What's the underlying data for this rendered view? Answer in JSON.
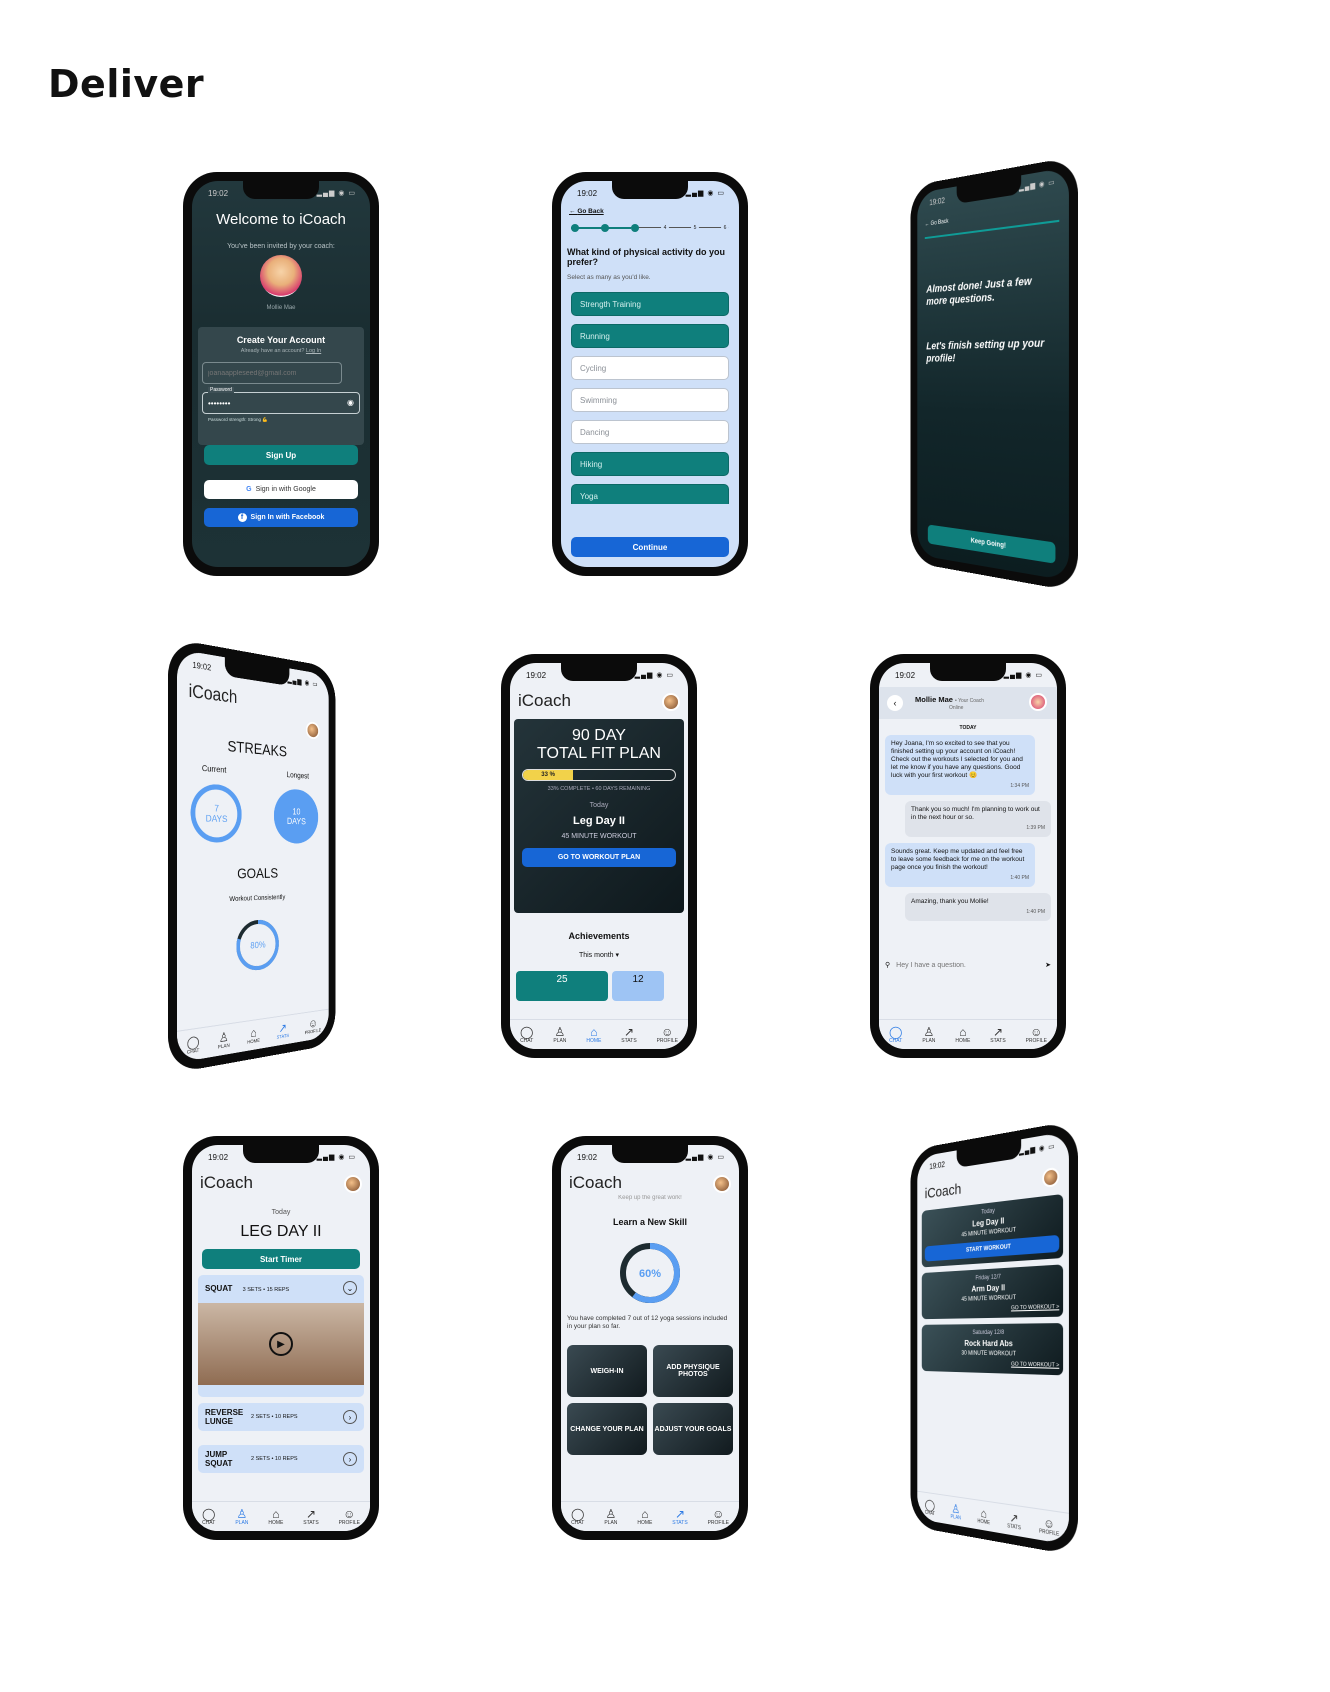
{
  "heading": "Deliver",
  "status_time": "19:02",
  "signup": {
    "title": "Welcome to iCoach",
    "invited": "You've been invited by your coach:",
    "coach_name": "Mollie Mae",
    "create": "Create Your Account",
    "have_account": "Already have an account?",
    "login": "Log In",
    "email_placeholder": "joanaappleseed@gmail.com",
    "password_label": "Password",
    "password_value": "••••••••",
    "strength": "Password strength: Strong 💪",
    "signup_btn": "Sign Up",
    "google_btn": "Sign in with Google",
    "facebook_btn": "Sign In with Facebook"
  },
  "quiz": {
    "back": "Go Back",
    "steps": [
      "1",
      "2",
      "3",
      "4",
      "5",
      "6"
    ],
    "question": "What kind of physical activity do you prefer?",
    "hint": "Select as many as you'd like.",
    "options": [
      {
        "label": "Strength Training",
        "selected": true
      },
      {
        "label": "Running",
        "selected": true
      },
      {
        "label": "Cycling",
        "selected": false
      },
      {
        "label": "Swimming",
        "selected": false
      },
      {
        "label": "Dancing",
        "selected": false
      },
      {
        "label": "Hiking",
        "selected": true
      },
      {
        "label": "Yoga",
        "selected": true
      }
    ],
    "continue": "Continue"
  },
  "almost": {
    "back": "Go Back",
    "line1": "Almost done! Just a few more questions.",
    "line2": "Let's finish setting up your profile!",
    "btn": "Keep Going!"
  },
  "stats": {
    "logo": "iCoach",
    "streaks": "STREAKS",
    "current": "Current",
    "longest": "Longest",
    "current_val": "7",
    "current_unit": "DAYS",
    "longest_val": "10",
    "longest_unit": "DAYS",
    "goals": "GOALS",
    "goal_label": "Workout Consistently",
    "goal_pct": "80%",
    "goal_fraction": 0.8
  },
  "home": {
    "logo": "iCoach",
    "plan_title1": "90 DAY",
    "plan_title2": "TOTAL FIT PLAN",
    "progress_label": "33 %",
    "progress": 0.33,
    "complete": "33% COMPLETE • 60 DAYS REMAINING",
    "today": "Today",
    "workout": "Leg Day II",
    "duration": "45 MINUTE WORKOUT",
    "go_btn": "GO TO WORKOUT PLAN",
    "achievements": "Achievements",
    "period": "This month",
    "ach1": "25",
    "ach2": "12"
  },
  "chat": {
    "coach": "Mollie Mae",
    "role": "Your Coach",
    "online": "Online",
    "day": "TODAY",
    "messages": [
      {
        "text": "Hey Joana, I'm so excited to see that you finished setting up your account on iCoach! Check out the workouts I selected for you and let me know if you have any questions. Good luck with your first workout 😊",
        "time": "1:34 PM",
        "dir": "in"
      },
      {
        "text": "Thank you so much! I'm planning to work out in the next hour or so.",
        "time": "1:39 PM",
        "dir": "out"
      },
      {
        "text": "Sounds great. Keep me updated and feel free to leave some feedback for me on the workout page once you finish the workout!",
        "time": "1:40 PM",
        "dir": "in"
      },
      {
        "text": "Amazing, thank you Mollie!",
        "time": "1:40 PM",
        "dir": "out"
      }
    ],
    "input_placeholder": "Hey I have a question."
  },
  "plan": {
    "logo": "iCoach",
    "today": "Today",
    "title": "LEG DAY II",
    "timer": "Start Timer",
    "exercises": [
      {
        "name": "SQUAT",
        "detail": "3 SETS • 15 REPS"
      },
      {
        "name": "REVERSE LUNGE",
        "detail": "2 SETS • 10 REPS"
      },
      {
        "name": "JUMP SQUAT",
        "detail": "2 SETS • 10 REPS"
      }
    ]
  },
  "skill": {
    "logo": "iCoach",
    "faded": "Keep up the great work!",
    "title": "Learn a New Skill",
    "pct": "60%",
    "fraction": 0.6,
    "desc": "You have completed 7 out of 12 yoga sessions included in your plan so far.",
    "tiles": [
      "WEIGH-IN",
      "ADD PHYSIQUE PHOTOS",
      "CHANGE YOUR PLAN",
      "ADJUST YOUR GOALS"
    ]
  },
  "schedule": {
    "logo": "iCoach",
    "items": [
      {
        "day": "Today",
        "name": "Leg Day II",
        "dur": "45 MINUTE WORKOUT",
        "action": "START WORKOUT"
      },
      {
        "day": "Friday 12/7",
        "name": "Arm Day II",
        "dur": "45 MINUTE WORKOUT",
        "action": "GO TO WORKOUT >"
      },
      {
        "day": "Saturday 12/8",
        "name": "Rock Hard Abs",
        "dur": "30 MINUTE WORKOUT",
        "action": "GO TO WORKOUT >"
      }
    ]
  },
  "nav": {
    "chat": "CHAT",
    "plan": "PLAN",
    "home": "HOME",
    "stats": "STATS",
    "profile": "PROFILE"
  },
  "colors": {
    "teal": "#0f7f7c",
    "blue": "#1766d6",
    "accent": "#2d7be5",
    "dark": "#1d2b30"
  }
}
